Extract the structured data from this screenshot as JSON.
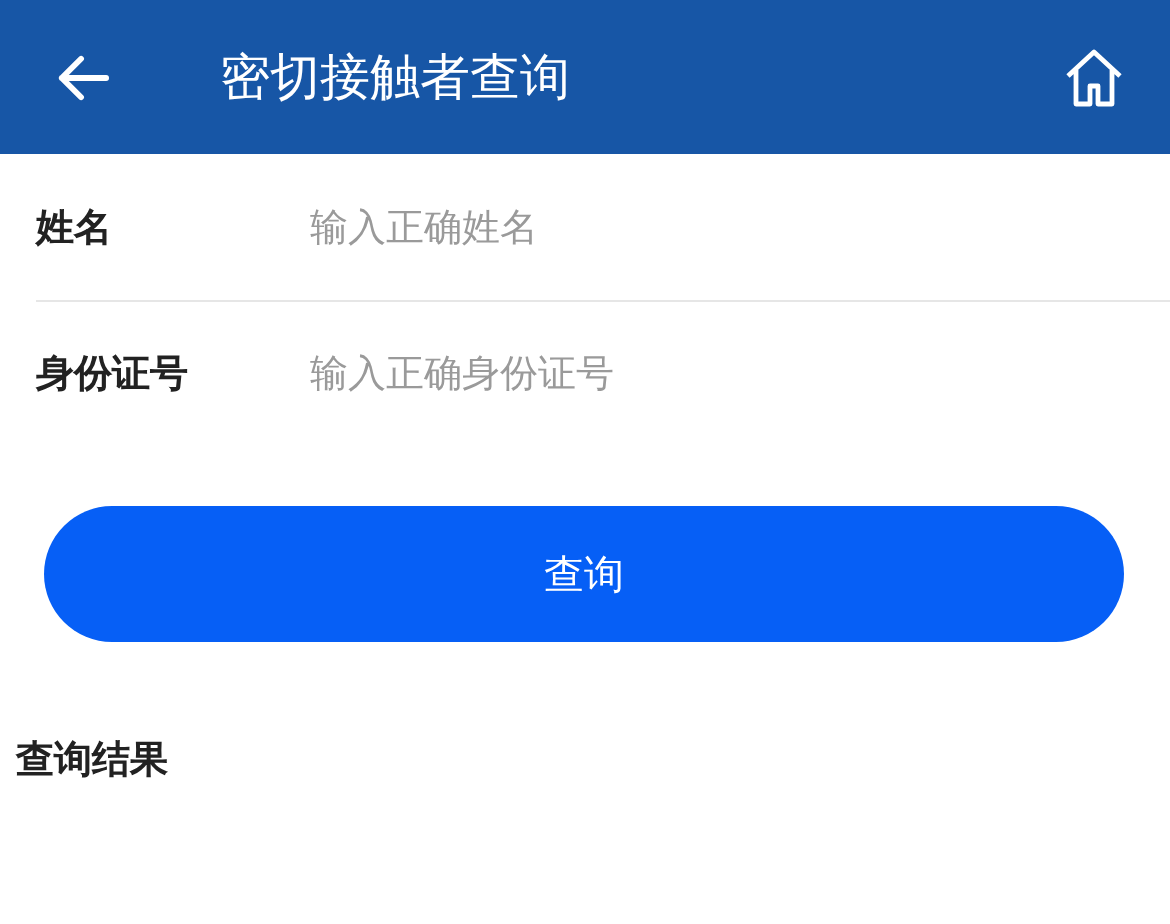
{
  "header": {
    "title": "密切接触者查询"
  },
  "fields": [
    {
      "label": "姓名",
      "placeholder": "输入正确姓名"
    },
    {
      "label": "身份证号",
      "placeholder": "输入正确身份证号"
    }
  ],
  "button": {
    "label": "查询"
  },
  "results": {
    "title": "查询结果"
  }
}
